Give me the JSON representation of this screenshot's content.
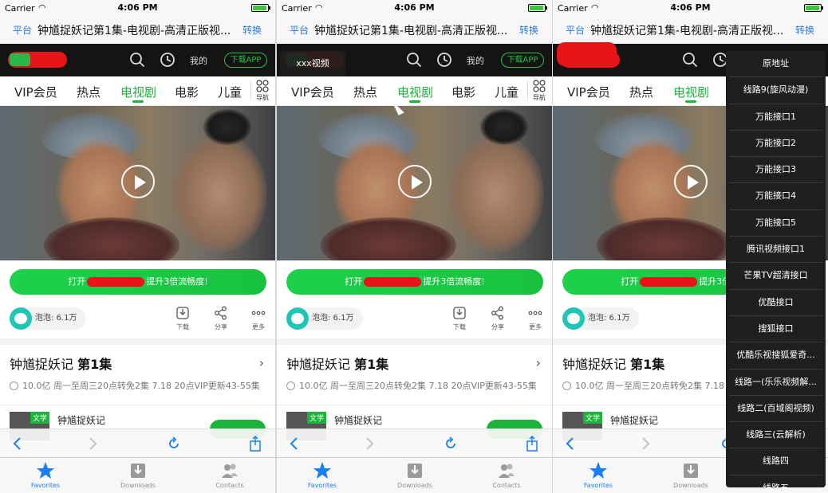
{
  "status": {
    "carrier": "Carrier",
    "time": "4:06 PM"
  },
  "titlebar": {
    "platform_label": "平台",
    "title": "钟馗捉妖记第1集-电视剧-高清正版视...",
    "convert_label": "转换"
  },
  "site_header": {
    "mine_label": "我的",
    "download_app_label": "下载APP"
  },
  "nav": {
    "categories": [
      "VIP会员",
      "热点",
      "电视剧",
      "电影",
      "儿童"
    ],
    "active_index": 2,
    "more_label": "导航"
  },
  "banner": {
    "text_suffix": "提升3倍流畅度!",
    "text_prefix": "打开"
  },
  "bubble": {
    "label": "泡泡: 6.1万"
  },
  "actions": {
    "download": "下载",
    "share": "分享",
    "more": "更多"
  },
  "episode": {
    "show_title": "钟馗捉妖记",
    "episode_label": "第1集",
    "meta": "10.0亿  周一至周三20点转免2集 7.18 20点VIP更新43-55集"
  },
  "recommend": {
    "tag": "文学",
    "name": "钟馗捉妖记"
  },
  "tabbar": {
    "favorites": "Favorites",
    "downloads": "Downloads",
    "contacts": "Contacts"
  },
  "tooltip": {
    "text": "xxx视频"
  },
  "dropdown": {
    "items": [
      "原地址",
      "线路9(旋风动漫)",
      "万能接口1",
      "万能接口2",
      "万能接口3",
      "万能接口4",
      "万能接口5",
      "腾讯视频接口1",
      "芒果TV超清接口",
      "优酷接口",
      "搜狐接口",
      "优酷乐视搜狐爱奇...",
      "线路一(乐乐视频解...",
      "线路二(百域阁视频)",
      "线路三(云解析)",
      "线路四",
      "线路五"
    ]
  },
  "colors": {
    "accent_green": "#1bb33a",
    "ios_blue": "#1a7ef5",
    "header_black": "#141414"
  }
}
